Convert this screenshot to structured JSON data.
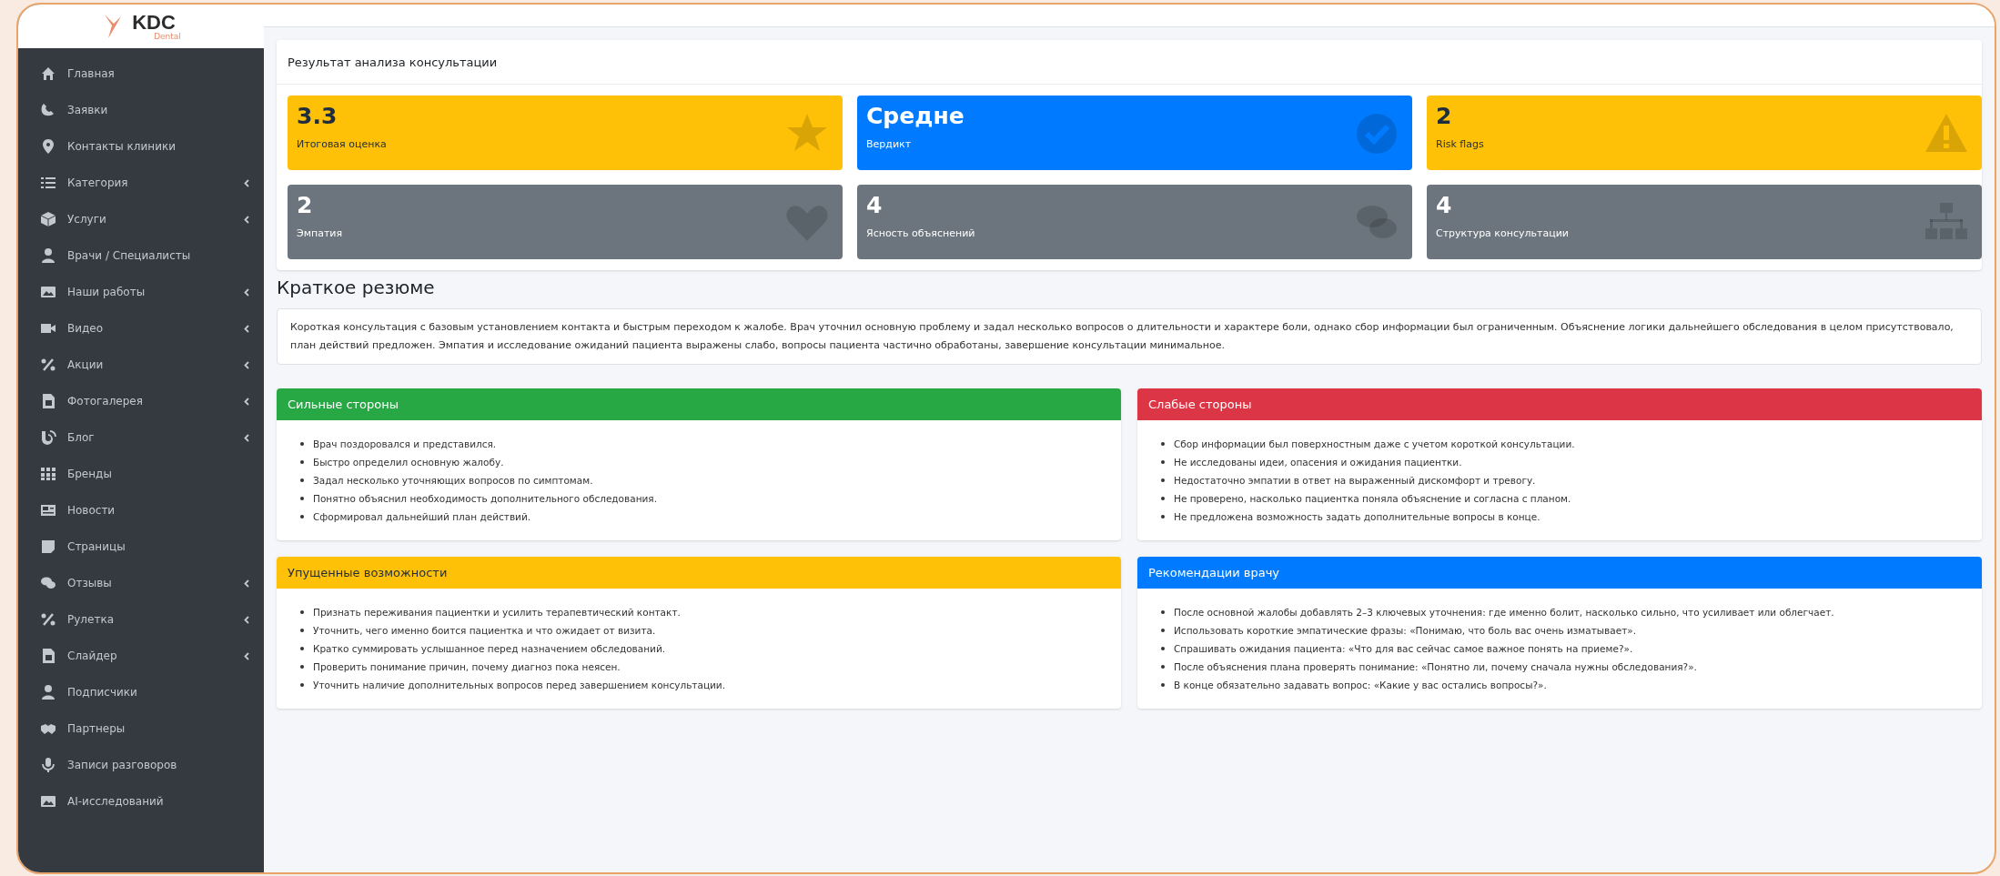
{
  "logo": {
    "title": "KDC",
    "subtitle": "Dental"
  },
  "sidebar": {
    "items": [
      {
        "label": "Главная",
        "has_submenu": false
      },
      {
        "label": "Заявки",
        "has_submenu": false
      },
      {
        "label": "Контакты клиники",
        "has_submenu": false
      },
      {
        "label": "Категория",
        "has_submenu": true
      },
      {
        "label": "Услуги",
        "has_submenu": true
      },
      {
        "label": "Врачи / Специалисты",
        "has_submenu": false
      },
      {
        "label": "Наши работы",
        "has_submenu": true
      },
      {
        "label": "Видео",
        "has_submenu": true
      },
      {
        "label": "Акции",
        "has_submenu": true
      },
      {
        "label": "Фотогалерея",
        "has_submenu": true
      },
      {
        "label": "Блог",
        "has_submenu": true
      },
      {
        "label": "Бренды",
        "has_submenu": false
      },
      {
        "label": "Новости",
        "has_submenu": false
      },
      {
        "label": "Страницы",
        "has_submenu": false
      },
      {
        "label": "Отзывы",
        "has_submenu": true
      },
      {
        "label": "Рулетка",
        "has_submenu": true
      },
      {
        "label": "Слайдер",
        "has_submenu": true
      },
      {
        "label": "Подписчики",
        "has_submenu": false
      },
      {
        "label": "Партнеры",
        "has_submenu": false
      },
      {
        "label": "Записи разговоров",
        "has_submenu": false
      },
      {
        "label": "AI-исследований",
        "has_submenu": false
      }
    ]
  },
  "result_card": {
    "title": "Результат анализа консультации",
    "boxes": [
      {
        "value": "3.3",
        "label": "Итоговая оценка",
        "kind": "warning"
      },
      {
        "value": "Средне",
        "label": "Вердикт",
        "kind": "primary"
      },
      {
        "value": "2",
        "label": "Risk flags",
        "kind": "warning"
      },
      {
        "value": "2",
        "label": "Эмпатия",
        "kind": "secondary"
      },
      {
        "value": "4",
        "label": "Ясность объяснений",
        "kind": "secondary"
      },
      {
        "value": "4",
        "label": "Структура консультации",
        "kind": "secondary"
      }
    ]
  },
  "summary": {
    "title": "Краткое резюме",
    "text": "Короткая консультация с базовым установлением контакта и быстрым переходом к жалобе. Врач уточнил основную проблему и задал несколько вопросов о длительности и характере боли, однако сбор информации был ограниченным. Объяснение логики дальнейшего обследования в целом присутствовало, план действий предложен. Эмпатия и исследование ожиданий пациента выражены слабо, вопросы пациента частично обработаны, завершение консультации минимальное."
  },
  "sections": [
    {
      "title": "Сильные стороны",
      "kind": "success",
      "items": [
        "Врач поздоровался и представился.",
        "Быстро определил основную жалобу.",
        "Задал несколько уточняющих вопросов по симптомам.",
        "Понятно объяснил необходимость дополнительного обследования.",
        "Сформировал дальнейший план действий."
      ]
    },
    {
      "title": "Слабые стороны",
      "kind": "danger",
      "items": [
        "Сбор информации был поверхностным даже с учетом короткой консультации.",
        "Не исследованы идеи, опасения и ожидания пациентки.",
        "Недостаточно эмпатии в ответ на выраженный дискомфорт и тревогу.",
        "Не проверено, насколько пациентка поняла объяснение и согласна с планом.",
        "Не предложена возможность задать дополнительные вопросы в конце."
      ]
    },
    {
      "title": "Упущенные возможности",
      "kind": "warning",
      "items": [
        "Признать переживания пациентки и усилить терапевтический контакт.",
        "Уточнить, чего именно боится пациентка и что ожидает от визита.",
        "Кратко суммировать услышанное перед назначением обследований.",
        "Проверить понимание причин, почему диагноз пока неясен.",
        "Уточнить наличие дополнительных вопросов перед завершением консультации."
      ]
    },
    {
      "title": "Рекомендации врачу",
      "kind": "primary",
      "items": [
        "После основной жалобы добавлять 2–3 ключевых уточнения: где именно болит, насколько сильно, что усиливает или облегчает.",
        "Использовать короткие эмпатические фразы: «Понимаю, что боль вас очень изматывает».",
        "Спрашивать ожидания пациента: «Что для вас сейчас самое важное понять на приеме?».",
        "После объяснения плана проверять понимание: «Понятно ли, почему сначала нужны обследования?».",
        "В конце обязательно задавать вопрос: «Какие у вас остались вопросы?»."
      ]
    }
  ]
}
